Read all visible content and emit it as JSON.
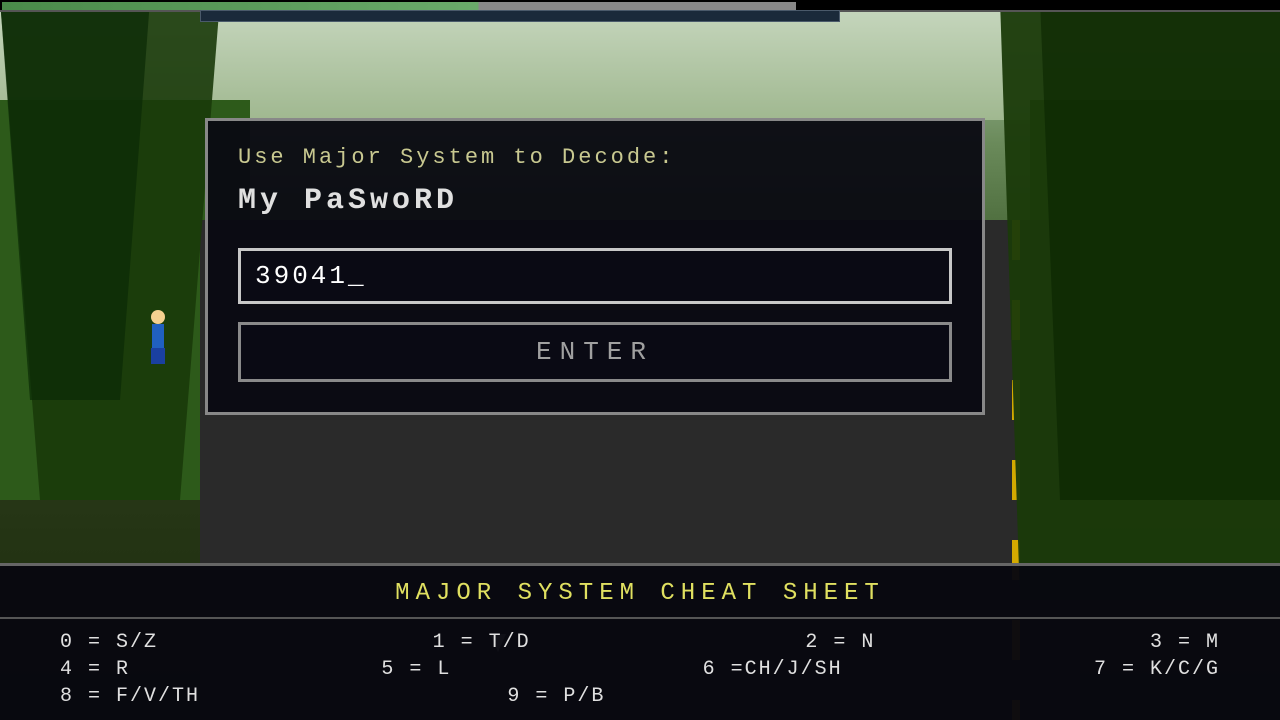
{
  "background": {
    "description": "3D road game scene with trees and sky"
  },
  "dialog": {
    "instruction": "Use Major System to Decode:",
    "password": "My PaSwoRD",
    "input_value": "39041_",
    "input_placeholder": "39041_",
    "enter_label": "ENTER"
  },
  "cheat_sheet": {
    "title": "MAJOR SYSTEM CHEAT SHEET",
    "rows": [
      {
        "items": [
          "0 = S/Z",
          "1 = T/D",
          "2 = N",
          "3 = M"
        ]
      },
      {
        "items": [
          "4 = R",
          "5 = L",
          "6 =CH/J/SH",
          "7 = K/C/G"
        ]
      },
      {
        "items": [
          "8 = F/V/TH",
          "9 = P/B",
          "",
          ""
        ]
      }
    ]
  },
  "progress_bar": {
    "percent": 62
  }
}
